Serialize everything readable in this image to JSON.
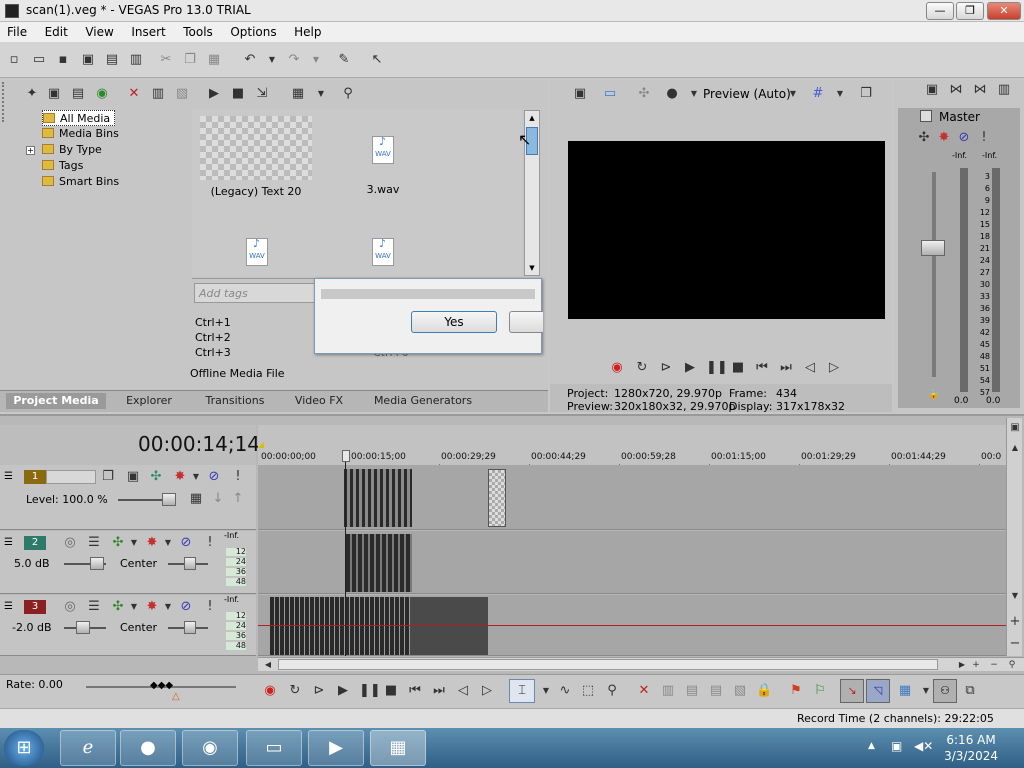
{
  "window": {
    "title": "scan(1).veg * - VEGAS Pro 13.0 TRIAL",
    "min": "—",
    "max": "❐",
    "close": "✕"
  },
  "menu": [
    "File",
    "Edit",
    "View",
    "Insert",
    "Tools",
    "Options",
    "Help"
  ],
  "media_tree": [
    "All Media",
    "Media Bins",
    "By Type",
    "Tags",
    "Smart Bins"
  ],
  "media_items": [
    {
      "label": "(Legacy) Text 20"
    },
    {
      "label": "3.wav"
    },
    {
      "label": ""
    },
    {
      "label": ""
    }
  ],
  "wav_badge": "WAV",
  "tags_placeholder": "Add tags",
  "shortcuts": [
    "Ctrl+1",
    "Ctrl+2",
    "Ctrl+3"
  ],
  "shortcut_partial": "Ctrl+0",
  "offline_media": "Offline Media File",
  "dialog": {
    "yes_label": "Yes"
  },
  "left_tabs": [
    "Project Media",
    "Explorer",
    "Transitions",
    "Video FX",
    "Media Generators"
  ],
  "preview": {
    "mode_label": "Preview (Auto)",
    "project_label": "Project:",
    "project_value": "1280x720, 29.970p",
    "preview_label": "Preview:",
    "preview_value": "320x180x32, 29.970p",
    "frame_label": "Frame:",
    "frame_value": "434",
    "display_label": "Display:",
    "display_value": "317x178x32"
  },
  "master": {
    "title": "Master",
    "inf_l": "-Inf.",
    "inf_r": "-Inf.",
    "scale": [
      "3",
      "6",
      "9",
      "12",
      "15",
      "18",
      "21",
      "24",
      "27",
      "30",
      "33",
      "36",
      "39",
      "42",
      "45",
      "48",
      "51",
      "54",
      "57"
    ],
    "bottom_l": "0.0",
    "bottom_r": "0.0"
  },
  "timeline": {
    "timecode": "00:00:14;14",
    "ruler": [
      "00:00:00;00",
      "00:00:15;00",
      "00:00:29;29",
      "00:00:44;29",
      "00:00:59;28",
      "00:01:15;00",
      "00:01:29;29",
      "00:01:44;29",
      "00:0"
    ],
    "tracks": [
      {
        "num": "1",
        "label": "Level: 100.0 %",
        "color": "#8a6a10"
      },
      {
        "num": "2",
        "label": "5.0 dB",
        "pan": "Center",
        "color": "#2d7a6a"
      },
      {
        "num": "3",
        "label": "-2.0 dB",
        "pan": "Center",
        "color": "#8a2020"
      }
    ],
    "meter_inf": "-Inf.",
    "meter_scale": [
      "12",
      "24",
      "36",
      "48"
    ],
    "rate": "Rate: 0.00",
    "record_time": "Record Time (2 channels): 29:22:05"
  },
  "taskbar": {
    "time": "6:16 AM",
    "date": "3/3/2024"
  }
}
